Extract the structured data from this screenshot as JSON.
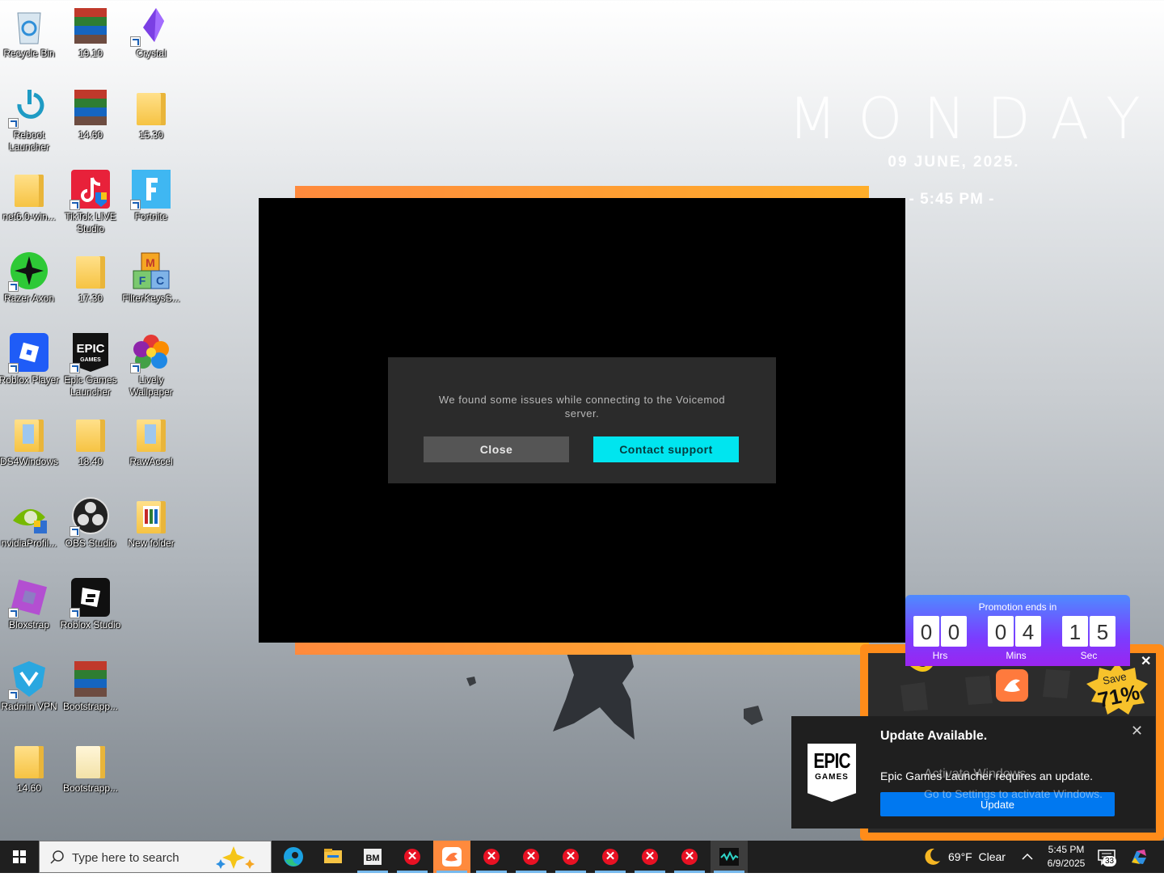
{
  "desktop": {
    "icons": [
      {
        "label": "Recycle Bin",
        "icon": "recycle-bin"
      },
      {
        "label": "19.10",
        "icon": "winrar-archive"
      },
      {
        "label": "Crystal",
        "icon": "crystal"
      },
      {
        "label": "Reboot Launcher",
        "icon": "reboot-launcher"
      },
      {
        "label": "14.60",
        "icon": "winrar-archive"
      },
      {
        "label": "15.30",
        "icon": "folder"
      },
      {
        "label": "net6.0-win...",
        "icon": "folder"
      },
      {
        "label": "TikTok LIVE Studio",
        "icon": "tiktok"
      },
      {
        "label": "Fortnite",
        "icon": "fortnite"
      },
      {
        "label": "Razer Axon",
        "icon": "razer-axon"
      },
      {
        "label": "17.30",
        "icon": "folder"
      },
      {
        "label": "FilterKeysS...",
        "icon": "filterkeys"
      },
      {
        "label": "Roblox Player",
        "icon": "roblox"
      },
      {
        "label": "Epic Games Launcher",
        "icon": "epic-games"
      },
      {
        "label": "Lively Wallpaper",
        "icon": "lively"
      },
      {
        "label": "DS4Windows",
        "icon": "folder-blue"
      },
      {
        "label": "18.40",
        "icon": "folder"
      },
      {
        "label": "RawAccel",
        "icon": "folder-blue"
      },
      {
        "label": "nvidiaProfil...",
        "icon": "nvidia"
      },
      {
        "label": "OBS Studio",
        "icon": "obs"
      },
      {
        "label": "New folder",
        "icon": "folder"
      },
      {
        "label": "Bloxstrap",
        "icon": "bloxstrap"
      },
      {
        "label": "Roblox Studio",
        "icon": "roblox-studio"
      },
      {
        "label": "Radmin VPN",
        "icon": "radmin"
      },
      {
        "label": "Bootstrapp...",
        "icon": "winrar-archive"
      },
      {
        "label": "14.60",
        "icon": "folder"
      },
      {
        "label": "Bootstrapp...",
        "icon": "folder"
      }
    ]
  },
  "clock_widget": {
    "day": "MONDAY",
    "date": "09 JUNE, 2025.",
    "time": "- 5:45 PM -"
  },
  "dialog": {
    "message": "We found some issues while connecting to the Voicemod server.",
    "close_label": "Close",
    "support_label": "Contact support",
    "support_color": "#00e5ef"
  },
  "promo": {
    "title": "Promotion ends in",
    "digits": [
      "0",
      "0",
      "0",
      "4",
      "1",
      "5"
    ],
    "units": [
      "Hrs",
      "Mins",
      "Sec"
    ],
    "save_label": "Save",
    "save_value": "71%"
  },
  "toast": {
    "title": "Update Available.",
    "body": "Epic Games Launcher requires an update.",
    "button": "Update",
    "logo_top": "EPIC",
    "logo_bottom": "GAMES"
  },
  "watermark": {
    "line1": "Activate Windows",
    "line2": "Go to Settings to activate Windows."
  },
  "taskbar": {
    "search_placeholder": "Type here to search",
    "weather": "69°F  Clear",
    "time": "5:45 PM",
    "date": "6/9/2025",
    "notification_count": "33"
  }
}
